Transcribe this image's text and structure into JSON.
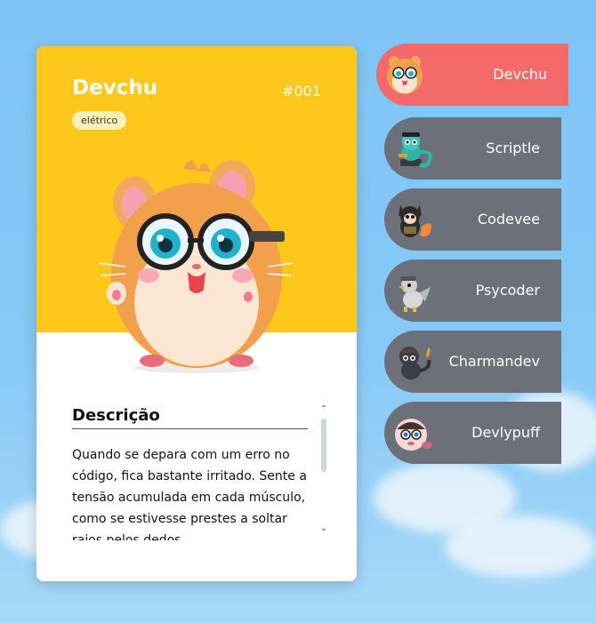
{
  "card": {
    "name": "Devchu",
    "number": "#001",
    "type": "elétrico",
    "description_title": "Descrição",
    "description_text": "Quando se depara com um erro no código, fica bastante irritado. Sente a tensão acumulada em cada músculo, como se estivesse prestes a soltar raios pelos dedos.",
    "top_color": "#fdc71c"
  },
  "nav": {
    "items": [
      {
        "label": "Devchu",
        "icon": "hamster-avatar-icon",
        "active": true
      },
      {
        "label": "Scriptle",
        "icon": "turtle-avatar-icon",
        "active": false
      },
      {
        "label": "Codevee",
        "icon": "fox-avatar-icon",
        "active": false
      },
      {
        "label": "Psycoder",
        "icon": "duck-avatar-icon",
        "active": false
      },
      {
        "label": "Charmandev",
        "icon": "lizard-avatar-icon",
        "active": false
      },
      {
        "label": "Devlypuff",
        "icon": "puff-avatar-icon",
        "active": false
      }
    ],
    "active_color": "#f46a6a",
    "inactive_color": "#6b7079"
  }
}
